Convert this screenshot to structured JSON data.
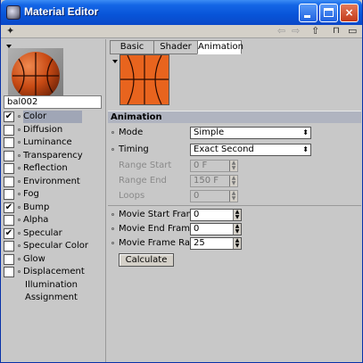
{
  "window": {
    "title": "Material Editor"
  },
  "titlebar_buttons": {
    "minimize": "minimize",
    "maximize": "maximize",
    "close": "×"
  },
  "toolbar": {
    "menu_icon": "material-menu-icon",
    "back": "⇦",
    "forward": "⇨",
    "up": "⇧",
    "lock": "🔓",
    "new": "▭"
  },
  "material": {
    "name": "bal002"
  },
  "channels": [
    {
      "label": "Color",
      "checked": true,
      "selected": true
    },
    {
      "label": "Diffusion",
      "checked": false
    },
    {
      "label": "Luminance",
      "checked": false
    },
    {
      "label": "Transparency",
      "checked": false
    },
    {
      "label": "Reflection",
      "checked": false
    },
    {
      "label": "Environment",
      "checked": false
    },
    {
      "label": "Fog",
      "checked": false
    },
    {
      "label": "Bump",
      "checked": true
    },
    {
      "label": "Alpha",
      "checked": false
    },
    {
      "label": "Specular",
      "checked": true
    },
    {
      "label": "Specular Color",
      "checked": false
    },
    {
      "label": "Glow",
      "checked": false
    },
    {
      "label": "Displacement",
      "checked": false
    }
  ],
  "extra_items": [
    "Illumination",
    "Assignment"
  ],
  "tabs": [
    {
      "label": "Basic",
      "active": false
    },
    {
      "label": "Shader",
      "active": false
    },
    {
      "label": "Animation",
      "active": true
    }
  ],
  "animation": {
    "header": "Animation",
    "mode_label": "Mode",
    "mode_value": "Simple",
    "timing_label": "Timing",
    "timing_value": "Exact Second",
    "range_start_label": "Range Start",
    "range_start_value": "0 F",
    "range_end_label": "Range End",
    "range_end_value": "150 F",
    "loops_label": "Loops",
    "loops_value": "0",
    "movie_start_label": "Movie Start Frame",
    "movie_start_value": "0",
    "movie_end_label": "Movie End Frame",
    "movie_end_value": "0",
    "movie_rate_label": "Movie Frame Rate",
    "movie_rate_value": "25",
    "calculate_label": "Calculate"
  },
  "colors": {
    "title_bar": "#0854d8",
    "preview": "#e8641e",
    "selection": "#a0a6b6"
  }
}
